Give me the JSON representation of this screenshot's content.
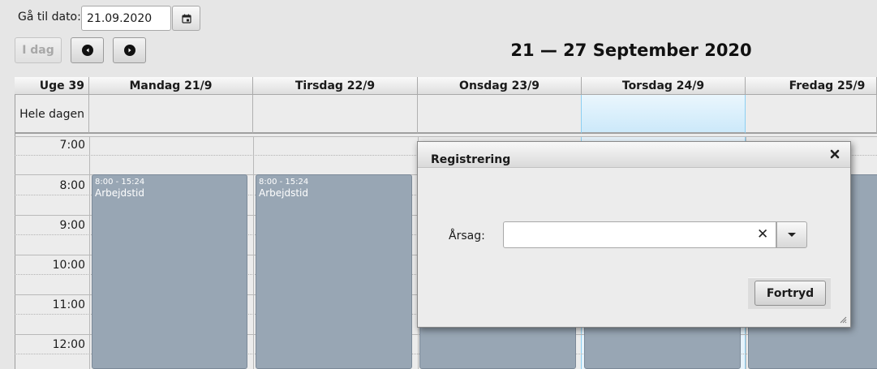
{
  "toolbar": {
    "goto_label": "Gå til dato:",
    "date_value": "21.09.2020",
    "today_label": "I dag",
    "calendar_icon": "calendar-icon",
    "prev_icon": "chevron-left-icon",
    "next_icon": "chevron-right-icon"
  },
  "header": {
    "week_range": "21 — 27 September 2020"
  },
  "calendar": {
    "week_label": "Uge 39",
    "all_day_label": "Hele dagen",
    "days": [
      {
        "label": "Mandag 21/9"
      },
      {
        "label": "Tirsdag 22/9"
      },
      {
        "label": "Onsdag 23/9"
      },
      {
        "label": "Torsdag 24/9"
      },
      {
        "label": "Fredag 25/9"
      }
    ],
    "today_index": 3,
    "hours": [
      "7:00",
      "8:00",
      "9:00",
      "10:00",
      "11:00",
      "12:00"
    ],
    "events": [
      {
        "time": "8:00 - 15:24",
        "title": "Arbejdstid"
      },
      {
        "time": "8:00 - 15:24",
        "title": "Arbejdstid"
      }
    ],
    "event_color": "#98a6b4",
    "today_color": "#cce9fa"
  },
  "dialog": {
    "title": "Registrering",
    "close_icon": "close-icon",
    "reason_label": "Årsag:",
    "reason_value": "",
    "clear_glyph": "✕",
    "cancel_label": "Fortryd"
  }
}
